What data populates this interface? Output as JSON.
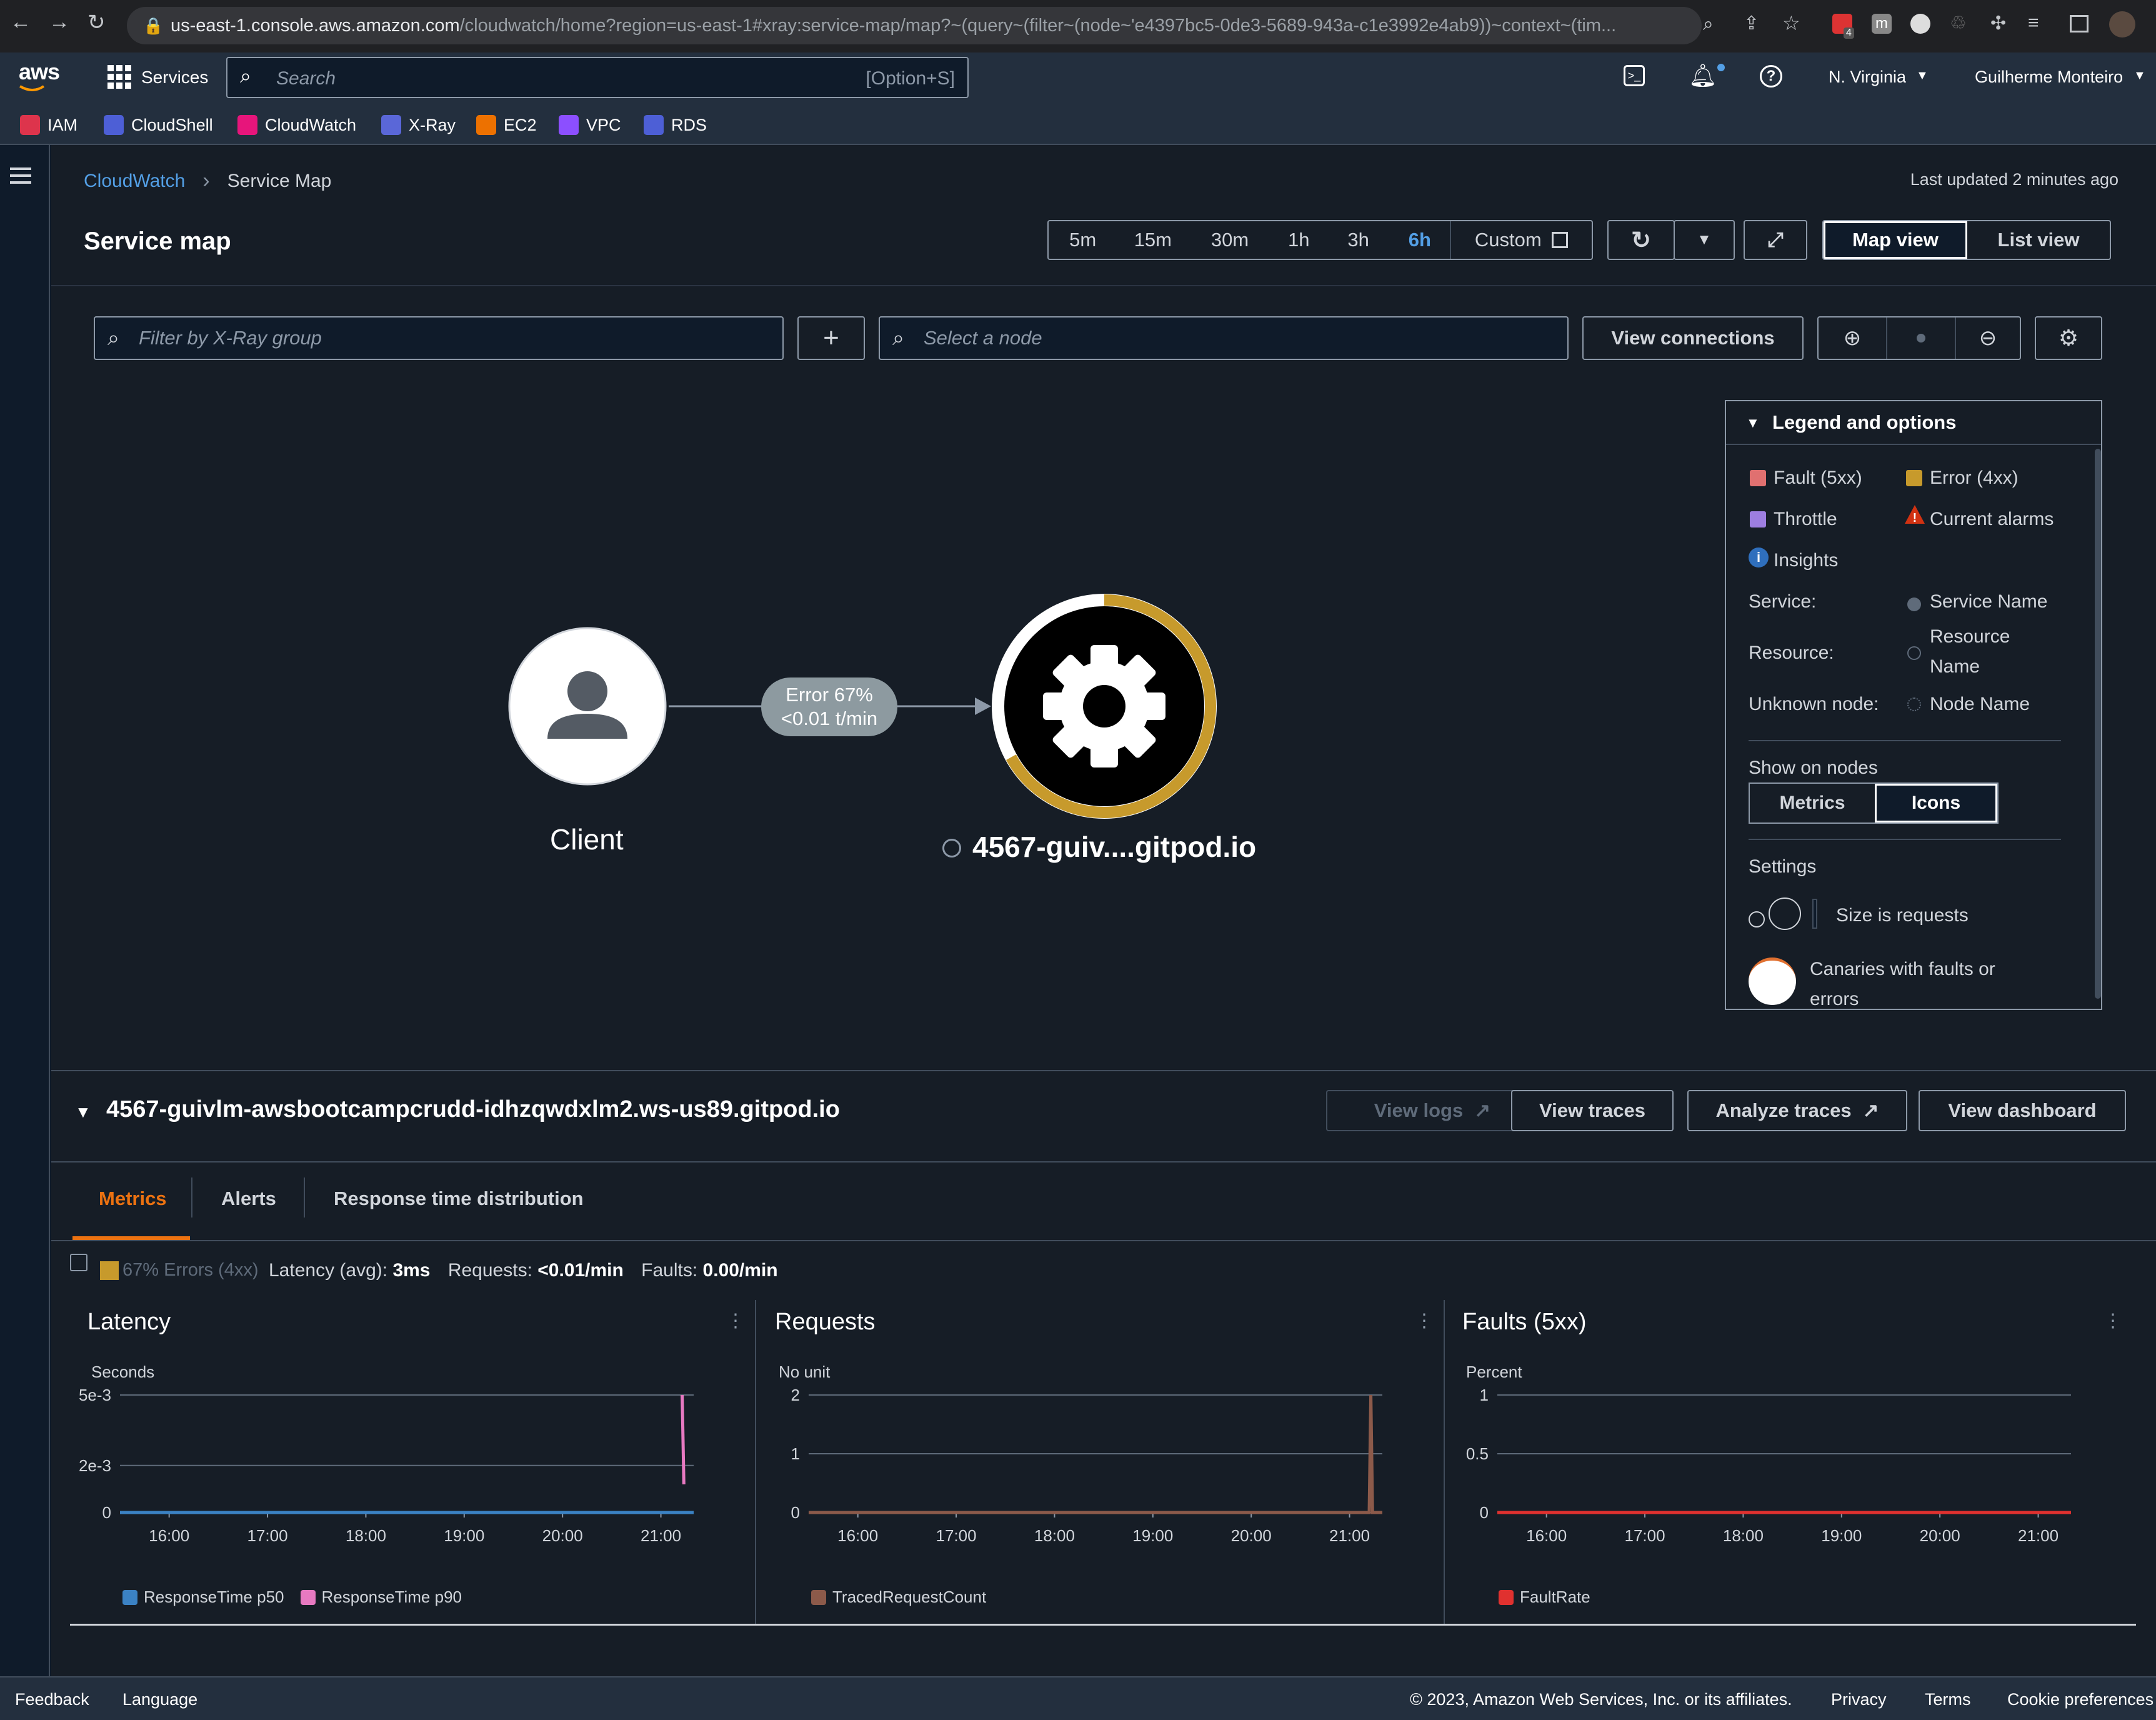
{
  "browser": {
    "url_host": "us-east-1.console.aws.amazon.com",
    "url_path": "/cloudwatch/home?region=us-east-1#xray:service-map/map?~(query~(filter~(node~'e4397bc5-0de3-5689-943a-c1e3992e4ab9))~context~(tim...",
    "ext_badge": "4"
  },
  "aws": {
    "logo": "aws",
    "services_label": "Services",
    "search_placeholder": "Search",
    "search_shortcut": "[Option+S]",
    "region": "N. Virginia",
    "user": "Guilherme Monteiro"
  },
  "bookmarks": [
    {
      "label": "IAM",
      "color": "#dd344c"
    },
    {
      "label": "CloudShell",
      "color": "#4d5fd6"
    },
    {
      "label": "CloudWatch",
      "color": "#e7157b"
    },
    {
      "label": "X-Ray",
      "color": "#5a67d8"
    },
    {
      "label": "EC2",
      "color": "#ed7100"
    },
    {
      "label": "VPC",
      "color": "#8c4fff"
    },
    {
      "label": "RDS",
      "color": "#4d5fd6"
    }
  ],
  "breadcrumb": {
    "root": "CloudWatch",
    "current": "Service Map"
  },
  "last_updated": "Last updated 2 minutes ago",
  "page_title": "Service map",
  "time_ranges": [
    "5m",
    "15m",
    "30m",
    "1h",
    "3h",
    "6h"
  ],
  "time_selected": "6h",
  "custom_label": "Custom",
  "view_toggle": {
    "map": "Map view",
    "list": "List view",
    "selected": "Map view"
  },
  "filters": {
    "group_placeholder": "Filter by X-Ray group",
    "node_placeholder": "Select a node",
    "view_connections": "View connections"
  },
  "map": {
    "client_label": "Client",
    "edge_label_1": "Error 67%",
    "edge_label_2": "<0.01 t/min",
    "service_label": "4567-guiv....gitpod.io",
    "error_fraction": 0.67,
    "error_color": "#c79a2c"
  },
  "legend": {
    "title": "Legend and options",
    "fault": "Fault (5xx)",
    "error": "Error (4xx)",
    "throttle": "Throttle",
    "alarms": "Current alarms",
    "insights": "Insights",
    "service_key": "Service:",
    "service_val": "Service Name",
    "resource_key": "Resource:",
    "resource_val_1": "Resource",
    "resource_val_2": "Name",
    "unknown_key": "Unknown node:",
    "unknown_val": "Node Name",
    "show_on_nodes": "Show on nodes",
    "metrics_btn": "Metrics",
    "icons_btn": "Icons",
    "settings": "Settings",
    "size_is_requests": "Size is requests",
    "canaries_1": "Canaries with faults or",
    "canaries_2": "errors",
    "colors": {
      "fault": "#e07070",
      "error": "#c79a2c",
      "throttle": "#9d7ee0"
    }
  },
  "node_detail": {
    "title": "4567-guivlm-awsbootcampcrudd-idhzqwdxlm2.ws-us89.gitpod.io",
    "view_logs": "View logs",
    "view_traces": "View traces",
    "analyze_traces": "Analyze traces",
    "view_dashboard": "View dashboard",
    "tabs": [
      "Metrics",
      "Alerts",
      "Response time distribution"
    ],
    "active_tab": "Metrics",
    "errors_chip": "67% Errors (4xx)",
    "latency_label": "Latency (avg):",
    "latency_val": "3ms",
    "requests_label": "Requests:",
    "requests_val": "<0.01/min",
    "faults_label": "Faults:",
    "faults_val": "0.00/min"
  },
  "chart_data": [
    {
      "type": "line",
      "title": "Latency",
      "ylabel": "Seconds",
      "x": [
        "15:30",
        "16:00",
        "17:00",
        "18:00",
        "19:00",
        "20:00",
        "21:00",
        "21:13",
        "21:14",
        "21:20"
      ],
      "xticks": [
        "16:00",
        "17:00",
        "18:00",
        "19:00",
        "20:00",
        "21:00"
      ],
      "yticks": [
        "5e-3",
        "2e-3",
        "0"
      ],
      "ylim": [
        0,
        0.005
      ],
      "series": [
        {
          "name": "ResponseTime p50",
          "color": "#3b82c4",
          "values": [
            0,
            0,
            0,
            0,
            0,
            0,
            0,
            0,
            0,
            0
          ]
        },
        {
          "name": "ResponseTime p90",
          "color": "#e779c1",
          "values": [
            null,
            null,
            null,
            null,
            null,
            null,
            null,
            0.005,
            0.0012,
            null
          ]
        }
      ]
    },
    {
      "type": "line",
      "title": "Requests",
      "ylabel": "No unit",
      "x": [
        "15:30",
        "16:00",
        "17:00",
        "18:00",
        "19:00",
        "20:00",
        "21:00",
        "21:12",
        "21:13",
        "21:14",
        "21:20"
      ],
      "xticks": [
        "16:00",
        "17:00",
        "18:00",
        "19:00",
        "20:00",
        "21:00"
      ],
      "yticks": [
        "2",
        "1",
        "0"
      ],
      "ylim": [
        0,
        2
      ],
      "series": [
        {
          "name": "TracedRequestCount",
          "color": "#8c5a4a",
          "values": [
            0,
            0,
            0,
            0,
            0,
            0,
            0,
            0,
            2,
            0,
            0
          ]
        }
      ]
    },
    {
      "type": "line",
      "title": "Faults (5xx)",
      "ylabel": "Percent",
      "x": [
        "15:30",
        "16:00",
        "17:00",
        "18:00",
        "19:00",
        "20:00",
        "21:00",
        "21:20"
      ],
      "xticks": [
        "16:00",
        "17:00",
        "18:00",
        "19:00",
        "20:00",
        "21:00"
      ],
      "yticks": [
        "1",
        "0.5",
        "0"
      ],
      "ylim": [
        0,
        1
      ],
      "series": [
        {
          "name": "FaultRate",
          "color": "#e0312f",
          "values": [
            0,
            0,
            0,
            0,
            0,
            0,
            0,
            0
          ]
        }
      ]
    }
  ],
  "footer": {
    "feedback": "Feedback",
    "language": "Language",
    "copyright": "© 2023, Amazon Web Services, Inc. or its affiliates.",
    "privacy": "Privacy",
    "terms": "Terms",
    "cookies": "Cookie preferences"
  }
}
